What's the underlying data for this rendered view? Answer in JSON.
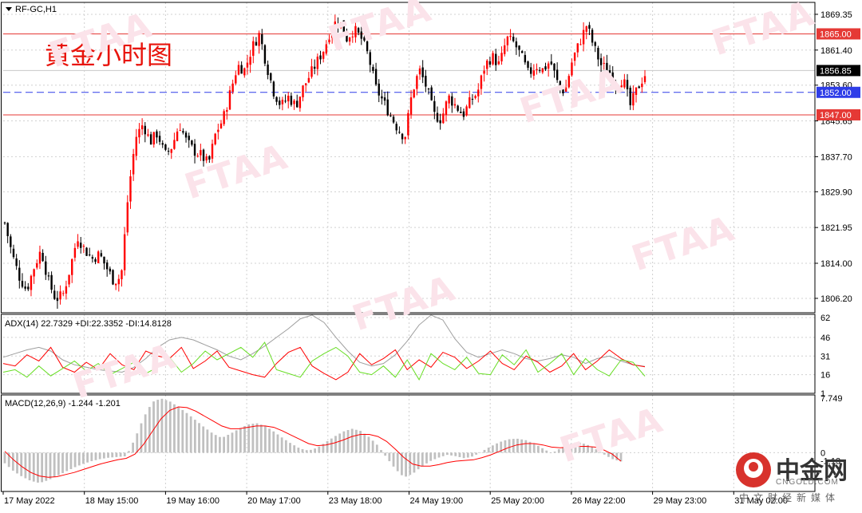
{
  "header": {
    "symbol": "RF-GC,H1",
    "chart_title": "黄金小时图"
  },
  "watermark": {
    "text": "FTAA"
  },
  "branding": {
    "name": "中金网",
    "domain": "CNGOLD.COM",
    "tagline": "中文财经新媒体"
  },
  "colors": {
    "bull": "#ff0000",
    "bear": "#000000",
    "level_line": "#e53935",
    "pivot_line": "#2e3de8",
    "last_price_bg": "#000000",
    "adx": "#9e9e9e",
    "plus_di": "#ff0000",
    "minus_di": "#66dd22",
    "macd_hist": "#c0c0c0",
    "macd_signal": "#ff0000"
  },
  "chart_data": [
    {
      "type": "candlestick",
      "symbol": "RF-GC",
      "timeframe": "H1",
      "title": "黄金小时图",
      "y_ticks": [
        "1869.35",
        "1861.40",
        "1853.60",
        "1845.65",
        "1837.70",
        "1829.90",
        "1821.95",
        "1814.00",
        "1806.20"
      ],
      "ylim": [
        1803.0,
        1872.0
      ],
      "x_ticks": [
        "17 May 2022",
        "18 May 15:00",
        "19 May 16:00",
        "20 May 17:00",
        "23 May 18:00",
        "24 May 19:00",
        "25 May 20:00",
        "26 May 22:00",
        "29 May 23:00",
        "31 May 02:00"
      ],
      "grid": true,
      "levels": [
        {
          "label": "1865.00",
          "value": 1865.0,
          "style": "solid"
        },
        {
          "label": "1852.00",
          "value": 1852.0,
          "style": "dashed"
        },
        {
          "label": "1847.00",
          "value": 1847.0,
          "style": "solid"
        }
      ],
      "last_price": {
        "label": "1856.85",
        "value": 1856.85
      },
      "close_path": [
        1823,
        1816,
        1811,
        1808,
        1813,
        1817,
        1810,
        1806,
        1807,
        1813,
        1820,
        1817,
        1815,
        1816,
        1813,
        1810,
        1811,
        1830,
        1842,
        1845,
        1841,
        1843,
        1838,
        1840,
        1845,
        1841,
        1839,
        1838,
        1836,
        1843,
        1846,
        1852,
        1858,
        1857,
        1862,
        1865,
        1858,
        1852,
        1849,
        1851,
        1849,
        1853,
        1856,
        1859,
        1862,
        1867,
        1868,
        1864,
        1866,
        1864,
        1860,
        1853,
        1850,
        1847,
        1844,
        1842,
        1852,
        1857,
        1853,
        1847,
        1846,
        1851,
        1849,
        1847,
        1850,
        1852,
        1858,
        1860,
        1858,
        1864,
        1863,
        1860,
        1856,
        1858,
        1857,
        1859,
        1854,
        1852,
        1859,
        1863,
        1867,
        1862,
        1858,
        1857,
        1854,
        1855,
        1849,
        1853,
        1856
      ],
      "series": [
        {
          "name": "RF-GC,H1"
        }
      ]
    },
    {
      "type": "line",
      "title": "ADX(14) 22.7329 +DI:22.3352 -DI:14.8128",
      "y_ticks": [
        "62",
        "46",
        "31",
        "16",
        "1"
      ],
      "ylim": [
        1,
        62
      ],
      "series": [
        {
          "name": "ADX(14)",
          "value": 22.7329,
          "values": [
            30,
            33,
            36,
            38,
            35,
            28,
            24,
            22,
            20,
            19,
            18,
            22,
            29,
            38,
            44,
            46,
            44,
            40,
            36,
            31,
            28,
            33,
            39,
            46,
            53,
            61,
            64,
            58,
            46,
            35,
            26,
            23,
            25,
            32,
            43,
            56,
            64,
            60,
            45,
            34,
            30,
            33,
            36,
            33,
            29,
            27,
            29,
            32,
            30,
            25,
            29,
            31,
            27,
            24,
            22.7
          ]
        },
        {
          "name": "+DI",
          "value": 22.3352,
          "values": [
            25,
            23,
            32,
            27,
            38,
            22,
            18,
            26,
            20,
            33,
            24,
            20,
            35,
            31,
            29,
            38,
            21,
            27,
            35,
            22,
            19,
            16,
            14,
            25,
            34,
            38,
            23,
            17,
            12,
            18,
            33,
            24,
            29,
            36,
            20,
            28,
            22,
            34,
            30,
            21,
            27,
            35,
            25,
            20,
            31,
            26,
            18,
            23,
            33,
            20,
            27,
            36,
            29,
            24,
            22.3
          ]
        },
        {
          "name": "-DI",
          "value": 14.8128,
          "values": [
            18,
            20,
            14,
            23,
            15,
            21,
            27,
            19,
            25,
            16,
            21,
            26,
            17,
            22,
            30,
            18,
            25,
            35,
            28,
            33,
            38,
            30,
            42,
            20,
            17,
            14,
            27,
            33,
            38,
            31,
            18,
            16,
            23,
            14,
            28,
            12,
            33,
            25,
            20,
            30,
            17,
            16,
            32,
            24,
            36,
            18,
            25,
            33,
            16,
            29,
            20,
            15,
            28,
            26,
            14.8
          ]
        }
      ]
    },
    {
      "type": "bar",
      "title": "MACD(12,26,9) -1.244 -1.201",
      "y_ticks": [
        "7.749",
        "0",
        "-1.13"
      ],
      "ylim": [
        -5.5,
        7.749
      ],
      "series": [
        {
          "name": "MACD(12,26,9)",
          "value": -1.244,
          "values": [
            -1.5,
            -2.6,
            -3.4,
            -4.0,
            -4.3,
            -3.9,
            -3.3,
            -2.7,
            -2.1,
            -1.6,
            -1.2,
            -0.9,
            -0.7,
            -0.6,
            -0.5,
            2.0,
            5.0,
            7.2,
            7.7,
            7.3,
            6.5,
            5.6,
            4.6,
            3.6,
            2.7,
            2.1,
            2.7,
            3.4,
            4.0,
            4.2,
            3.8,
            3.0,
            2.1,
            1.3,
            0.6,
            0.3,
            0.7,
            1.5,
            2.3,
            3.0,
            3.4,
            3.1,
            2.2,
            1.0,
            -0.7,
            -2.3,
            -3.5,
            -3.0,
            -2.0,
            -1.2,
            -0.7,
            -0.3,
            -0.5,
            -0.8,
            -0.5,
            0.2,
            0.9,
            1.5,
            1.9,
            2.0,
            1.8,
            1.3,
            0.6,
            -0.1,
            0.6,
            1.2,
            1.5,
            1.2,
            0.6,
            -0.2,
            -0.9,
            -1.24
          ]
        },
        {
          "name": "signal",
          "value": -1.201,
          "values": [
            0.2,
            -1.0,
            -2.0,
            -2.8,
            -3.3,
            -3.5,
            -3.4,
            -3.1,
            -2.8,
            -2.4,
            -2.0,
            -1.6,
            -1.3,
            -1.0,
            -0.8,
            -0.2,
            1.2,
            3.0,
            4.8,
            6.0,
            6.5,
            6.4,
            5.9,
            5.2,
            4.5,
            3.8,
            3.4,
            3.4,
            3.6,
            3.8,
            3.8,
            3.6,
            3.1,
            2.5,
            1.9,
            1.3,
            1.0,
            1.1,
            1.4,
            1.8,
            2.3,
            2.6,
            2.6,
            2.3,
            1.6,
            0.5,
            -0.7,
            -1.6,
            -1.9,
            -1.9,
            -1.7,
            -1.4,
            -1.2,
            -1.1,
            -1.0,
            -0.7,
            -0.3,
            0.2,
            0.7,
            1.1,
            1.3,
            1.3,
            1.1,
            0.8,
            0.7,
            0.8,
            0.9,
            0.9,
            0.8,
            0.4,
            -0.2,
            -1.2
          ]
        }
      ]
    }
  ]
}
